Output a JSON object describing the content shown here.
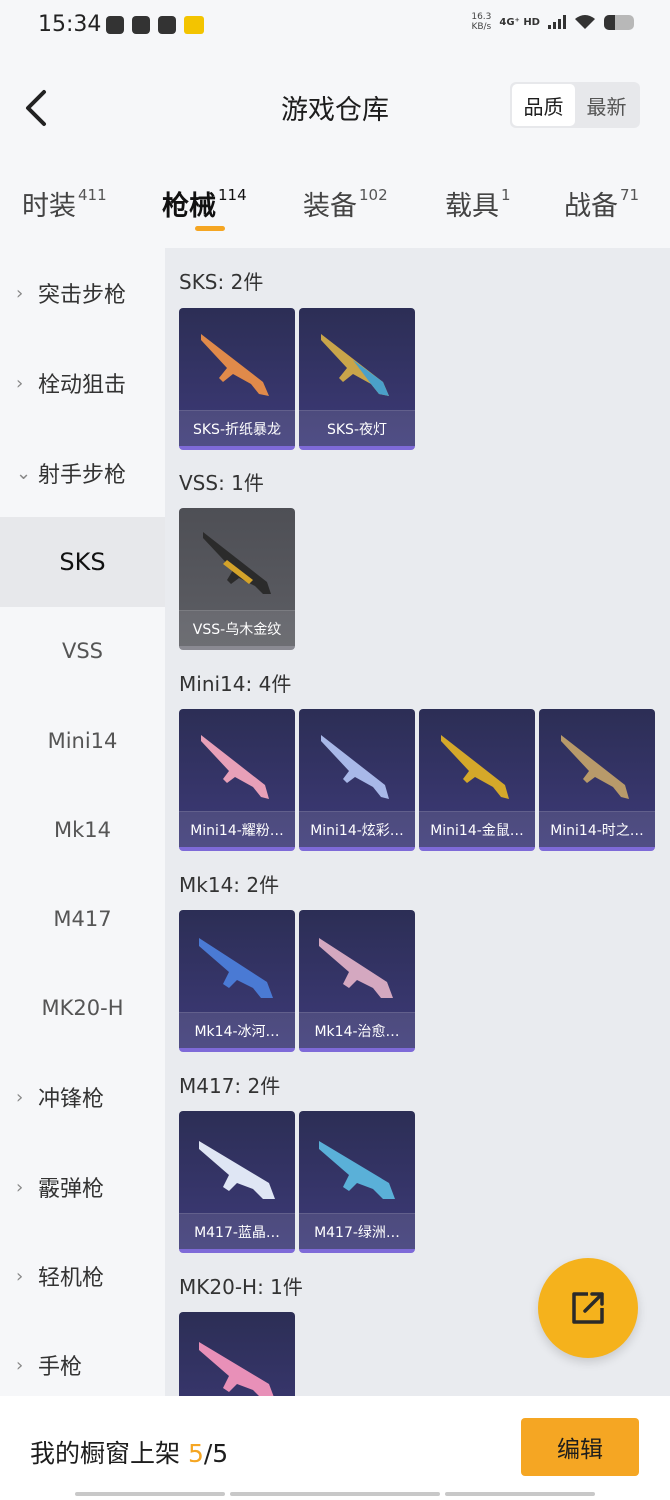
{
  "status_bar": {
    "time": "15:34",
    "net_speed_value": "16.3",
    "net_speed_unit": "KB/s",
    "net_type": "4G⁺ HD",
    "battery_fraction": 0.35
  },
  "header": {
    "title": "游戏仓库",
    "sort_options": [
      "品质",
      "最新"
    ],
    "sort_active": "品质"
  },
  "tabs": [
    {
      "label": "时装",
      "count": "411"
    },
    {
      "label": "枪械",
      "count": "114",
      "active": true
    },
    {
      "label": "装备",
      "count": "102"
    },
    {
      "label": "载具",
      "count": "1"
    },
    {
      "label": "战备",
      "count": "71"
    }
  ],
  "sidebar": {
    "items": [
      {
        "label": "突击步枪",
        "type": "category",
        "chevron": "›"
      },
      {
        "label": "栓动狙击",
        "type": "category",
        "chevron": "›"
      },
      {
        "label": "射手步枪",
        "type": "category",
        "chevron": "⌄"
      },
      {
        "label": "SKS",
        "type": "sub",
        "selected": true
      },
      {
        "label": "VSS",
        "type": "sub"
      },
      {
        "label": "Mini14",
        "type": "sub"
      },
      {
        "label": "Mk14",
        "type": "sub"
      },
      {
        "label": "M417",
        "type": "sub"
      },
      {
        "label": "MK20-H",
        "type": "sub"
      },
      {
        "label": "冲锋枪",
        "type": "category",
        "chevron": "›"
      },
      {
        "label": "霰弹枪",
        "type": "category",
        "chevron": "›"
      },
      {
        "label": "轻机枪",
        "type": "category",
        "chevron": "›"
      },
      {
        "label": "手枪",
        "type": "category",
        "chevron": "›"
      }
    ]
  },
  "groups": [
    {
      "title": "SKS: 2件",
      "items": [
        "SKS-折纸暴龙",
        "SKS-夜灯"
      ]
    },
    {
      "title": "VSS: 1件",
      "items": [
        "VSS-乌木金纹"
      ]
    },
    {
      "title": "Mini14: 4件",
      "items": [
        "Mini14-耀粉…",
        "Mini14-炫彩…",
        "Mini14-金鼠…",
        "Mini14-时之…"
      ]
    },
    {
      "title": "Mk14: 2件",
      "items": [
        "Mk14-冰河…",
        "Mk14-治愈…"
      ]
    },
    {
      "title": "M417: 2件",
      "items": [
        "M417-蓝晶…",
        "M417-绿洲…"
      ]
    },
    {
      "title": "MK20-H: 1件",
      "items": [
        ""
      ]
    }
  ],
  "bottom_bar": {
    "showcase_label": "我的橱窗上架",
    "showcase_count": "5",
    "showcase_total": "/5",
    "edit_label": "编辑"
  },
  "colors": {
    "accent": "#f5a623",
    "card_purple": "#3d3a78",
    "card_gray": "#5d5e64",
    "content_bg": "#e9ebef",
    "sidebar_bg": "#f6f7f9"
  },
  "icons": {
    "back": "chevron-left-icon",
    "share": "external-link-icon",
    "sidebar_collapsed": "chevron-right-icon",
    "sidebar_expanded": "chevron-down-icon"
  }
}
